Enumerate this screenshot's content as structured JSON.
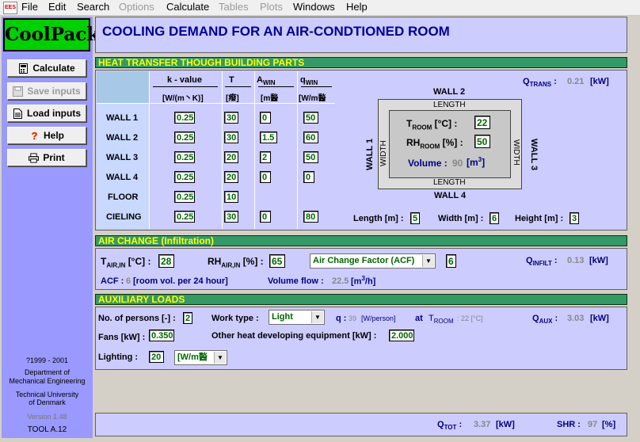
{
  "menu": {
    "app_icon": "EES",
    "items": [
      "File",
      "Edit",
      "Search",
      "Options",
      "Calculate",
      "Tables",
      "Plots",
      "Windows",
      "Help"
    ]
  },
  "sidebar": {
    "logo": "CoolPack",
    "buttons": [
      {
        "label": "Calculate",
        "icon": "calculator-icon"
      },
      {
        "label": "Save inputs",
        "icon": "save-icon"
      },
      {
        "label": "Load inputs",
        "icon": "document-icon"
      },
      {
        "label": "Help",
        "icon": "help-icon"
      },
      {
        "label": "Print",
        "icon": "printer-icon"
      }
    ],
    "copyright": "?1999 - 2001",
    "dept1": "Department of",
    "dept2": "Mechanical Engineering",
    "univ1": "Technical University",
    "univ2": "of Denmark",
    "version": "Version 1.48",
    "tool": "TOOL A.12"
  },
  "title": "COOLING DEMAND FOR AN AIR-CONDTIONED ROOM",
  "heat": {
    "header": "HEAT TRANSFER THOUGH BUILDING PARTS",
    "col_k": "k - value",
    "col_k_unit": "[W/(m丶K)]",
    "col_t": "T",
    "col_t_unit": "[癈]",
    "col_a": "A",
    "col_a_sub": "WIN",
    "col_a_unit": "[m醔",
    "col_q": "q",
    "col_q_sub": "WIN",
    "col_q_unit": "[W/m醔",
    "rows": [
      {
        "name": "WALL 1",
        "k": "0.25",
        "t": "30",
        "a": "0",
        "q": "50"
      },
      {
        "name": "WALL 2",
        "k": "0.25",
        "t": "30",
        "a": "1.5",
        "q": "60"
      },
      {
        "name": "WALL 3",
        "k": "0.25",
        "t": "20",
        "a": "2",
        "q": "50"
      },
      {
        "name": "WALL 4",
        "k": "0.25",
        "t": "20",
        "a": "0",
        "q": "0"
      },
      {
        "name": "FLOOR",
        "k": "0.25",
        "t": "10",
        "a": "",
        "q": ""
      },
      {
        "name": "CIELING",
        "k": "0.25",
        "t": "30",
        "a": "0",
        "q": "80"
      }
    ],
    "qtrans_label": "Q",
    "qtrans_sub": "TRANS",
    "qtrans_value": "0.21",
    "qtrans_unit": "[kW]",
    "wall1": "WALL 1",
    "wall2": "WALL 2",
    "wall3": "WALL 3",
    "wall4": "WALL 4",
    "length_top": "LENGTH",
    "length_bottom": "LENGTH",
    "width_left": "WIDTH",
    "width_right": "WIDTH",
    "troom_label": "T",
    "troom_sub": "ROOM",
    "troom_unit": "[°C] :",
    "troom_value": "22",
    "rh_label": "RH",
    "rh_sub": "ROOM",
    "rh_unit": "[%] :",
    "rh_value": "50",
    "volume_label": "Volume :",
    "volume_value": "90",
    "volume_unit": "[m",
    "volume_unit_sup": "3",
    "volume_unit_end": "]",
    "length_label": "Length [m] :",
    "length_value": "5",
    "width_label": "Width [m] :",
    "width_value": "6",
    "height_label": "Height [m] :",
    "height_value": "3"
  },
  "air": {
    "header": "AIR CHANGE (Infiltration)",
    "tair_label": "T",
    "tair_sub": "AIR,IN",
    "tair_unit": "[°C] :",
    "tair_value": "28",
    "rhair_label": "RH",
    "rhair_sub": "AIR,IN",
    "rhair_unit": "[%] :",
    "rhair_value": "65",
    "factor_select": "Air Change Factor (ACF)",
    "factor_value": "6",
    "qinfilt_label": "Q",
    "qinfilt_sub": "INFILT",
    "qinfilt_value": "0.13",
    "qinfilt_unit": "[kW]",
    "acf_label": "ACF :",
    "acf_value": "6",
    "acf_unit": "[room vol. per 24 hour]",
    "flow_label": "Volume flow :",
    "flow_value": "22.5",
    "flow_unit": "[m",
    "flow_unit_sup": "3",
    "flow_unit_end": "/h]"
  },
  "aux": {
    "header": "AUXILIARY LOADS",
    "persons_label": "No. of persons [-] :",
    "persons_value": "2",
    "work_label": "Work type :",
    "work_select": "Light",
    "q_label": "q :",
    "q_value": "39",
    "q_unit": "[W/person]",
    "at_label": "at",
    "at_t": "T",
    "at_sub": "ROOM",
    "at_value": ": 22 [°C]",
    "qaux_label": "Q",
    "qaux_sub": "AUX",
    "qaux_value": "3.03",
    "qaux_unit": "[kW]",
    "fans_label": "Fans [kW] :",
    "fans_value": "0.350",
    "other_label": "Other heat developing equipment [kW] :",
    "other_value": "2.000",
    "lighting_label": "Lighting :",
    "lighting_value": "20",
    "lighting_select": "[W/m醔"
  },
  "totals": {
    "qtot_label": "Q",
    "qtot_sub": "TOT",
    "qtot_value": "3.37",
    "qtot_unit": "[kW]",
    "shr_label": "SHR :",
    "shr_value": "97",
    "shr_unit": "[%]"
  }
}
